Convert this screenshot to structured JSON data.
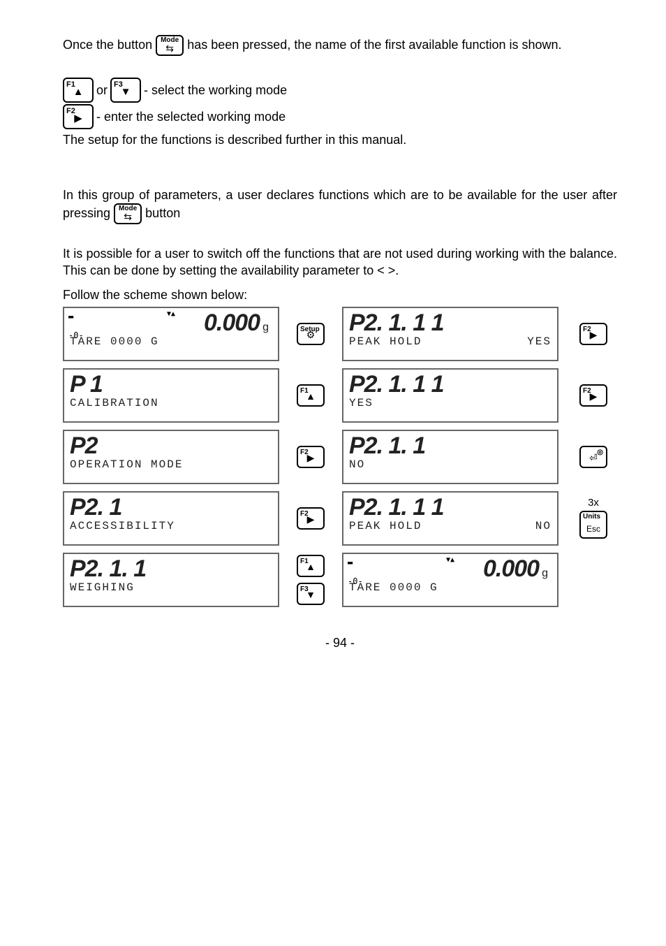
{
  "intro": {
    "line1a": "Once the button ",
    "line1b": " has been pressed, the name of the first available function is shown."
  },
  "modeBtn": {
    "sup": "Mode",
    "sym": "⇆"
  },
  "keys": {
    "f1": {
      "sup": "F1",
      "sym": "▲"
    },
    "f2": {
      "sup": "F2",
      "sym": "▶"
    },
    "f3": {
      "sup": "F3",
      "sym": "▼"
    },
    "setup": {
      "sup": "Setup",
      "sym": "⚙"
    },
    "enter": {
      "sup": "",
      "sym": "⏎",
      "extra": "◎"
    },
    "units": {
      "sup": "Units",
      "sym": "Esc"
    }
  },
  "selectText": " - select the working mode",
  "enterText": " - enter the selected working mode",
  "setupNote": "The setup for the functions is described further in this manual.",
  "groupIntro1": "In this group of parameters, a user declares functions which are to be available for the user after pressing ",
  "groupIntro2": " button",
  "switchOff": "It is possible for a user to switch off the functions that are not used during working with the balance. This can be done by setting the availability parameter to <     >.",
  "schemeTitle": "Follow the scheme shown below:",
  "lcd": {
    "zerog": {
      "top": "▼▲",
      "left1": "▬",
      "left2": "-0-",
      "big": "0.000",
      "unit": "g",
      "bottom": "TARE 0000 G"
    },
    "p1": {
      "big": "P 1",
      "bottom": "CALIBRATION"
    },
    "p2": {
      "big": "P2",
      "bottom": "OPERATION MODE"
    },
    "p21": {
      "big": "P2. 1",
      "bottom": "ACCESSIBILITY"
    },
    "p211wei": {
      "big": "P2. 1. 1",
      "bottom": "WEIGHING"
    },
    "p2111yes": {
      "big": "P2. 1. 1 1",
      "bottom": "PEAK HOLD",
      "val": "YES"
    },
    "p2111yes2": {
      "big": "P2. 1. 1 1",
      "bottom": "YES"
    },
    "p211no": {
      "big": "P2. 1. 1",
      "bottom": "NO"
    },
    "p2111no": {
      "big": "P2. 1. 1 1",
      "bottom": "PEAK HOLD",
      "val": "NO"
    }
  },
  "rightAnno": {
    "times": "3x"
  },
  "pageNum": "- 94 -"
}
